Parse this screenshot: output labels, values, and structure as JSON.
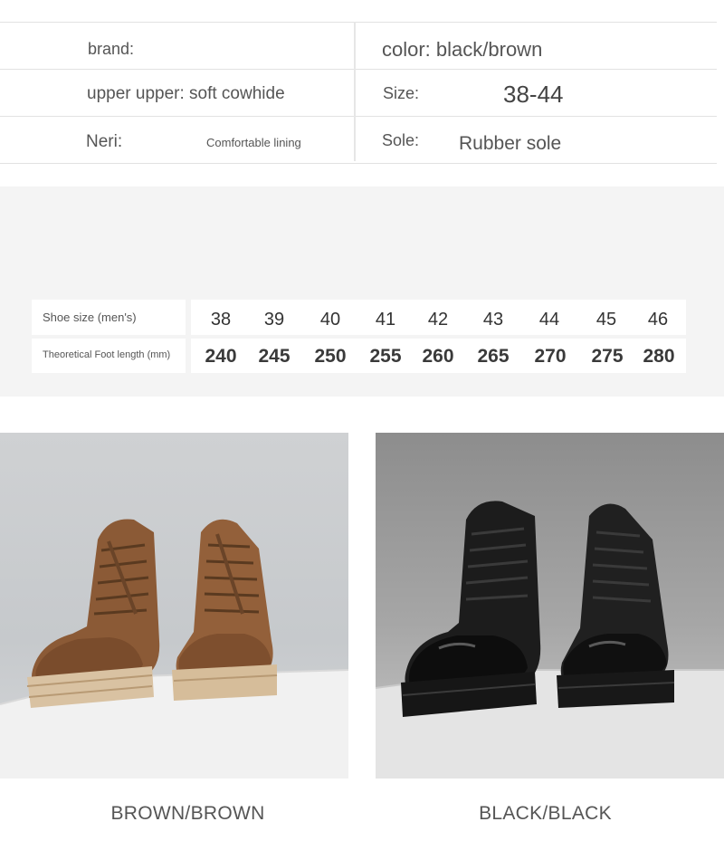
{
  "specs": {
    "brand_label": "brand:",
    "color": "color: black/brown",
    "upper": "upper upper: soft cowhide",
    "size_label": "Size:",
    "size_value": "38-44",
    "lining_label": "Neri:",
    "lining_value": "Comfortable lining",
    "sole_label": "Sole:",
    "sole_value": "Rubber sole"
  },
  "size_chart": {
    "row1_label": "Shoe size (men's)",
    "row2_label": "Theoretical Foot length (mm)",
    "sizes": [
      "38",
      "39",
      "40",
      "41",
      "42",
      "43",
      "44",
      "45",
      "46"
    ],
    "lengths": [
      "240",
      "245",
      "250",
      "255",
      "260",
      "265",
      "270",
      "275",
      "280"
    ]
  },
  "products": [
    {
      "caption": "BROWN/BROWN",
      "icon": "brown-boots-image",
      "color": "#8a5a3a"
    },
    {
      "caption": "BLACK/BLACK",
      "icon": "black-boots-image",
      "color": "#1a1a1a"
    }
  ]
}
